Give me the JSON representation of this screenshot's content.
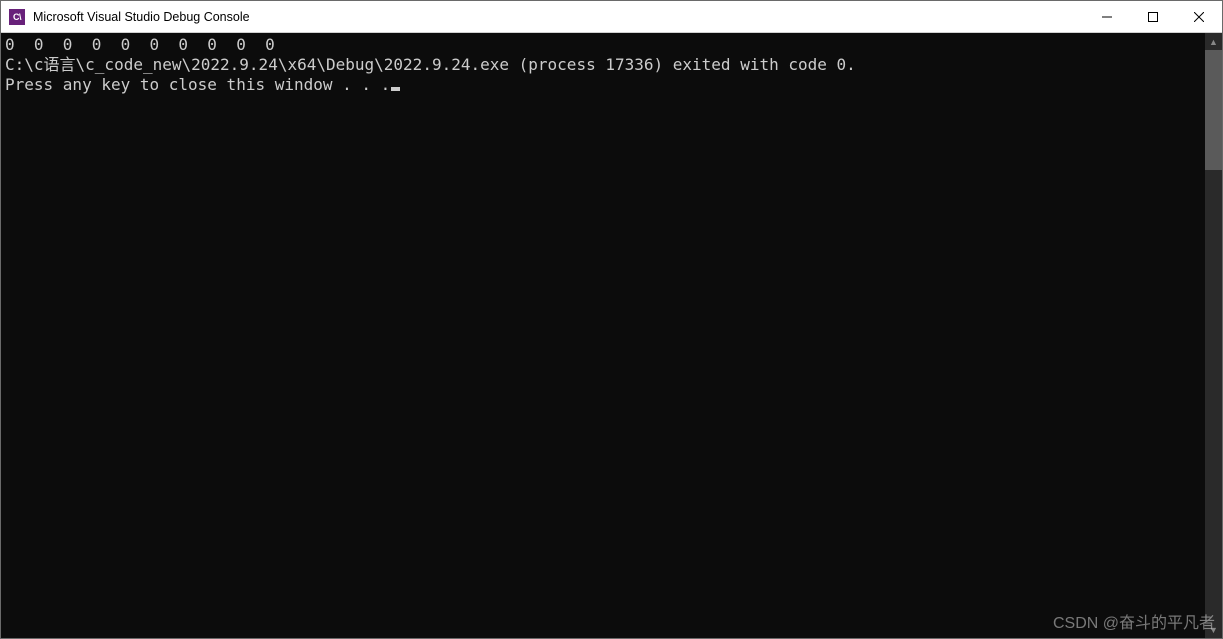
{
  "titlebar": {
    "icon_text": "C\\",
    "title": "Microsoft Visual Studio Debug Console"
  },
  "console": {
    "lines": {
      "0": "0  0  0  0  0  0  0  0  0  0",
      "1": "C:\\c语言\\c_code_new\\2022.9.24\\x64\\Debug\\2022.9.24.exe (process 17336) exited with code 0.",
      "2": "Press any key to close this window . . ."
    }
  },
  "watermark": "CSDN @奋斗的平凡者"
}
